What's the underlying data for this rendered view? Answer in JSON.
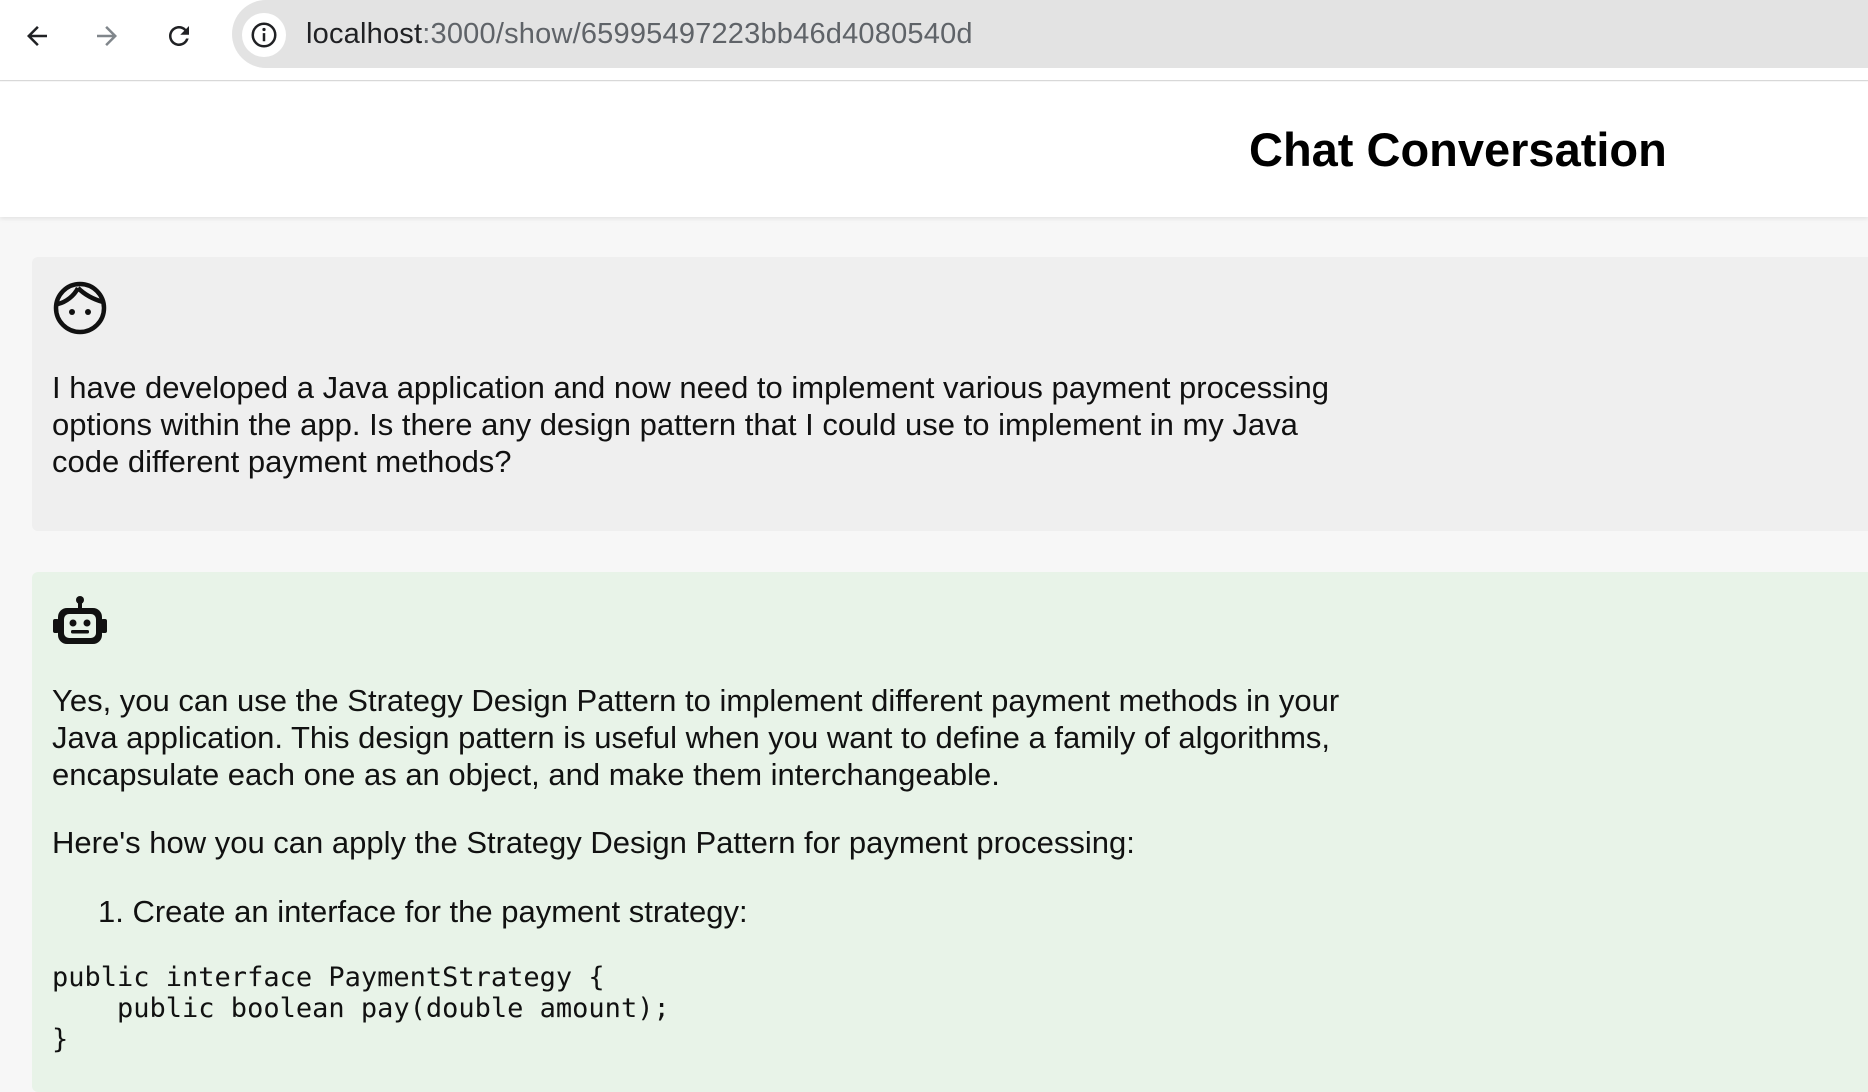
{
  "browser": {
    "url_host": "localhost",
    "url_path": ":3000/show/65995497223bb46d4080540d",
    "back_icon": "arrow-left",
    "forward_icon": "arrow-right",
    "reload_icon": "reload",
    "site_info_icon": "info-circle"
  },
  "page": {
    "title": "Chat Conversation"
  },
  "messages": {
    "user": {
      "avatar_icon": "face",
      "text": "I have developed a Java application and now need to implement various payment processing options within the app. Is there any design pattern that I could use to implement in my Java code different payment methods?"
    },
    "assistant": {
      "avatar_icon": "robot",
      "paragraph1": "Yes, you can use the Strategy Design Pattern to implement different payment methods in your Java application. This design pattern is useful when you want to define a family of algorithms, encapsulate each one as an object, and make them interchangeable.",
      "paragraph2": "Here's how you can apply the Strategy Design Pattern for payment processing:",
      "list_item_1": "1. Create an interface for the payment strategy:",
      "code": "public interface PaymentStrategy {\n    public boolean pay(double amount);\n}"
    }
  },
  "colors": {
    "user_bubble": "#efefef",
    "assistant_bubble": "#e8f3e8",
    "address_bar": "#e3e3e3"
  }
}
